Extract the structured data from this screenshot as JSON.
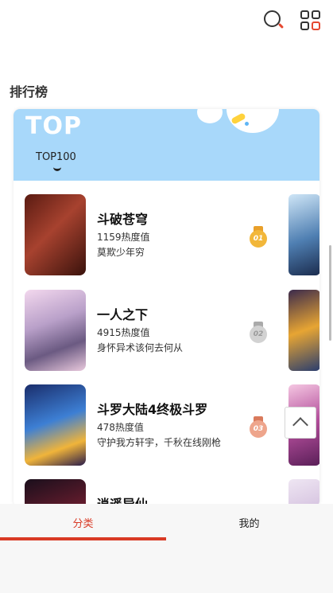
{
  "header": {
    "search_icon": "search-icon",
    "grid_icon": "apps-grid-icon"
  },
  "section": {
    "title": "排行榜"
  },
  "rank_card": {
    "header_title": "TOP",
    "header_color": "#a8d8fa",
    "tab": "TOP100",
    "items": [
      {
        "title": "斗破苍穹",
        "heat": "1159热度值",
        "desc": "莫欺少年穷",
        "medal": "01",
        "medal_color": "#f2b73a"
      },
      {
        "title": "一人之下",
        "heat": "4915热度值",
        "desc": "身怀异术该何去何从",
        "medal": "02",
        "medal_color": "#c7c7c7"
      },
      {
        "title": "斗罗大陆4终极斗罗",
        "heat": "478热度值",
        "desc": "守护我方轩宇，千秋在线刚枪",
        "medal": "03",
        "medal_color": "#e8967a"
      },
      {
        "title": "逍遥异仙",
        "heat": "",
        "desc": "",
        "medal": "",
        "medal_color": ""
      }
    ]
  },
  "back_to_top": {
    "icon": "chevron-up-icon"
  },
  "bottom_nav": {
    "items": [
      {
        "label": "分类",
        "active": true
      },
      {
        "label": "我的",
        "active": false
      }
    ],
    "accent": "#d93a25"
  }
}
